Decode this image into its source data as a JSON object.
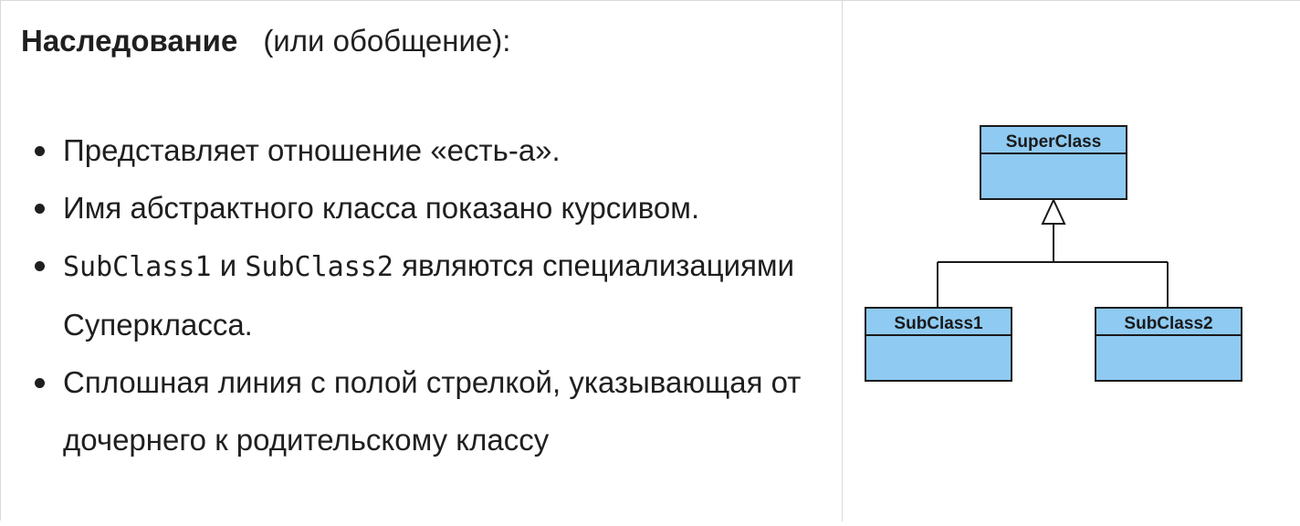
{
  "heading": {
    "bold": "Наследование",
    "rest": "(или обобщение):"
  },
  "bullets": [
    {
      "text": "Представляет отношение «есть-а»."
    },
    {
      "text": "Имя абстрактного класса показано курсивом."
    },
    {
      "code1": "SubClass1",
      "mid": " и ",
      "code2": "SubClass2",
      "text": " являются специализациями Суперкласса."
    },
    {
      "text": "Сплошная линия с полой стрелкой, указывающая от дочернего к родительскому классу"
    }
  ],
  "diagram": {
    "superclass": "SuperClass",
    "subclass1": "SubClass1",
    "subclass2": "SubClass2",
    "box_fill": "#8fcaf2",
    "line_color": "#1a1a1a"
  }
}
